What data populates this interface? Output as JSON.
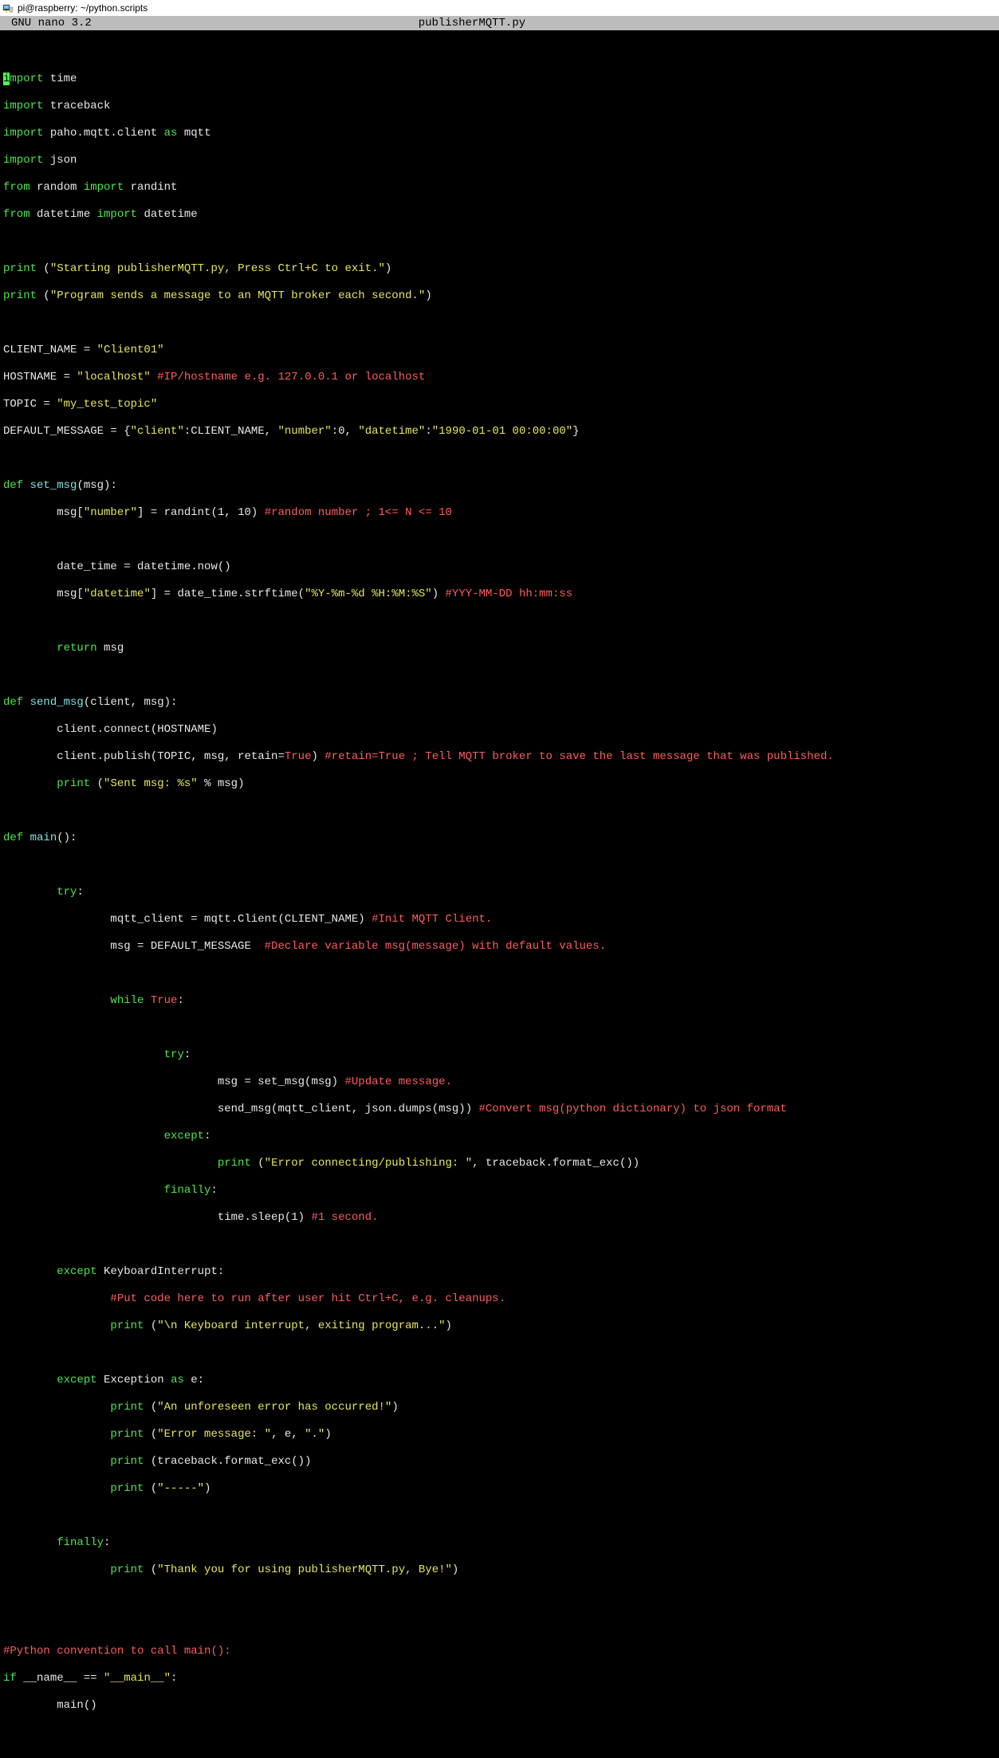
{
  "window": {
    "title": "pi@raspberry: ~/python.scripts"
  },
  "nano": {
    "app": "GNU nano 3.2",
    "filename": "publisherMQTT.py"
  },
  "code": {
    "l1_import": "mport",
    "l1_time": " time",
    "l2_import": "import",
    "l2_traceback": " traceback",
    "l3_import": "import",
    "l3_paho": " paho.mqtt.client ",
    "l3_as": "as",
    "l3_mqtt": " mqtt",
    "l4_import": "import",
    "l4_json": " json",
    "l5_from": "from",
    "l5_random": " random ",
    "l5_import": "import",
    "l5_randint": " randint",
    "l6_from": "from",
    "l6_datetime1": " datetime ",
    "l6_import": "import",
    "l6_datetime2": " datetime",
    "l8_print": "print",
    "l8_open": " (",
    "l8_str": "\"Starting publisherMQTT.py, Press Ctrl+C to exit.\"",
    "l8_close": ")",
    "l9_print": "print",
    "l9_open": " (",
    "l9_str": "\"Program sends a message to an MQTT broker each second.\"",
    "l9_close": ")",
    "l11_a": "CLIENT_NAME = ",
    "l11_str": "\"Client01\"",
    "l12_a": "HOSTNAME = ",
    "l12_str": "\"localhost\"",
    "l12_sp": " ",
    "l12_c": "#IP/hostname e.g. 127.0.0.1 or localhost",
    "l13_a": "TOPIC = ",
    "l13_str": "\"my_test_topic\"",
    "l14_a": "DEFAULT_MESSAGE = {",
    "l14_k1": "\"client\"",
    "l14_b": ":CLIENT_NAME, ",
    "l14_k2": "\"number\"",
    "l14_c": ":0, ",
    "l14_k3": "\"datetime\"",
    "l14_d": ":",
    "l14_v3": "\"1990-01-01 00:00:00\"",
    "l14_e": "}",
    "l16_def": "def",
    "l16_sp": " ",
    "l16_fn": "set_msg",
    "l16_args": "(msg):",
    "l17_a": "        msg[",
    "l17_k": "\"number\"",
    "l17_b": "] = randint(1, 10) ",
    "l17_c": "#random number ; 1<= N <= 10",
    "l19_a": "        date_time = datetime.now()",
    "l20_a": "        msg[",
    "l20_k": "\"datetime\"",
    "l20_b": "] = date_time.strftime(",
    "l20_fmt": "\"%Y-%m-%d %H:%M:%S\"",
    "l20_c": ") ",
    "l20_cm": "#YYY-MM-DD hh:mm:ss",
    "l22_ind": "        ",
    "l22_ret": "return",
    "l22_msg": " msg",
    "l24_def": "def",
    "l24_sp": " ",
    "l24_fn": "send_msg",
    "l24_args": "(client, msg):",
    "l25_a": "        client.connect(HOSTNAME)",
    "l26_a": "        client.publish(TOPIC, msg, retain=",
    "l26_true": "True",
    "l26_b": ") ",
    "l26_c": "#retain=True ; Tell MQTT broker to save the last message that was published.",
    "l27_ind": "        ",
    "l27_print": "print",
    "l27_a": " (",
    "l27_str": "\"Sent msg: %s\"",
    "l27_b": " % msg)",
    "l29_def": "def",
    "l29_sp": " ",
    "l29_fn": "main",
    "l29_args": "():",
    "l31_ind": "        ",
    "l31_try": "try",
    "l31_colon": ":",
    "l32_a": "                mqtt_client = mqtt.Client(CLIENT_NAME) ",
    "l32_c": "#Init MQTT Client.",
    "l33_a": "                msg = DEFAULT_MESSAGE  ",
    "l33_c": "#Declare variable msg(message) with default values.",
    "l35_ind": "                ",
    "l35_while": "while",
    "l35_sp": " ",
    "l35_true": "True",
    "l35_colon": ":",
    "l37_ind": "                        ",
    "l37_try": "try",
    "l37_colon": ":",
    "l38_a": "                                msg = set_msg(msg) ",
    "l38_c": "#Update message.",
    "l39_a": "                                send_msg(mqtt_client, json.dumps(msg)) ",
    "l39_c": "#Convert msg(python dictionary) to json format",
    "l40_ind": "                        ",
    "l40_except": "except",
    "l40_colon": ":",
    "l41_ind": "                                ",
    "l41_print": "print",
    "l41_a": " (",
    "l41_str": "\"Error connecting/publishing: \"",
    "l41_b": ", traceback.format_exc())",
    "l42_ind": "                        ",
    "l42_finally": "finally",
    "l42_colon": ":",
    "l43_a": "                                time.sleep(1) ",
    "l43_c": "#1 second.",
    "l45_ind": "        ",
    "l45_except": "except",
    "l45_a": " KeyboardInterrupt:",
    "l46_ind": "                ",
    "l46_c": "#Put code here to run after user hit Ctrl+C, e.g. cleanups.",
    "l47_ind": "                ",
    "l47_print": "print",
    "l47_a": " (",
    "l47_str": "\"\\n Keyboard interrupt, exiting program...\"",
    "l47_b": ")",
    "l49_ind": "        ",
    "l49_except": "except",
    "l49_a": " Exception ",
    "l49_as": "as",
    "l49_b": " e:",
    "l50_ind": "                ",
    "l50_print": "print",
    "l50_a": " (",
    "l50_str": "\"An unforeseen error has occurred!\"",
    "l50_b": ")",
    "l51_ind": "                ",
    "l51_print": "print",
    "l51_a": " (",
    "l51_str": "\"Error message: \"",
    "l51_b": ", e, ",
    "l51_str2": "\".\"",
    "l51_c": ")",
    "l52_ind": "                ",
    "l52_print": "print",
    "l52_a": " (traceback.format_exc())",
    "l53_ind": "                ",
    "l53_print": "print",
    "l53_a": " (",
    "l53_str": "\"-----\"",
    "l53_b": ")",
    "l55_ind": "        ",
    "l55_finally": "finally",
    "l55_colon": ":",
    "l56_ind": "                ",
    "l56_print": "print",
    "l56_a": " (",
    "l56_str": "\"Thank you for using publisherMQTT.py, Bye!\"",
    "l56_b": ")",
    "l59_c": "#Python convention to call main():",
    "l60_if": "if",
    "l60_a": " __name__ == ",
    "l60_str": "\"__main__\"",
    "l60_b": ":",
    "l61_a": "        main()"
  }
}
